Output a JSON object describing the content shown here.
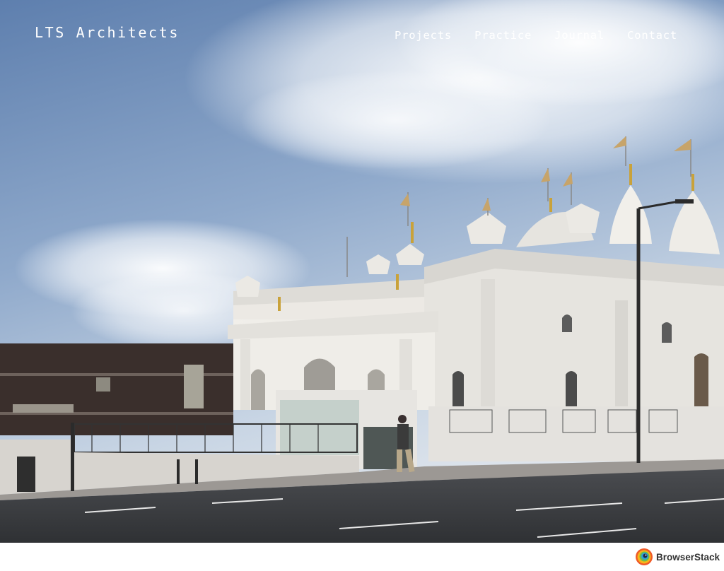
{
  "site": {
    "title": "LTS Architects"
  },
  "nav": {
    "items": [
      {
        "label": "Projects"
      },
      {
        "label": "Practice"
      },
      {
        "label": "Journal"
      },
      {
        "label": "Contact"
      }
    ]
  },
  "footer": {
    "badge_label": "BrowserStack",
    "badge_icon": "browserstack-logo-icon"
  },
  "colors": {
    "nav_text": "#ffffff",
    "sky_top": "#6f8fb7",
    "temple_white": "#e9e7e2",
    "road": "#3b3d41"
  }
}
